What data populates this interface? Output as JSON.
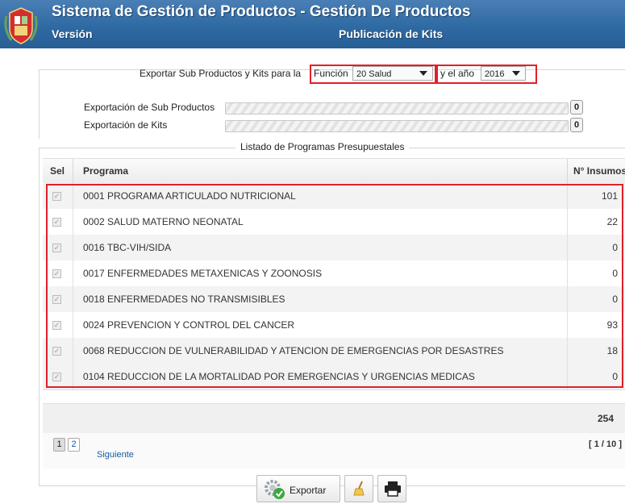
{
  "header": {
    "title": "Sistema de Gestión de Productos - Gestión De Productos",
    "version_label": "Versión",
    "subtitle": "Publicación de Kits"
  },
  "export": {
    "prefix_label": "Exportar Sub Productos y Kits para la",
    "funcion_label": "Función",
    "funcion_value": "20 Salud",
    "anio_label": "y el año",
    "anio_value": "2016",
    "subproductos_label": "Exportación de Sub Productos",
    "subproductos_count": "0",
    "kits_label": "Exportación de Kits",
    "kits_count": "0"
  },
  "list": {
    "legend": "Listado de Programas Presupuestales",
    "columns": {
      "sel": "Sel",
      "programa": "Programa",
      "insumos": "N° Insumos"
    },
    "rows": [
      {
        "programa": "0001 PROGRAMA ARTICULADO NUTRICIONAL",
        "insumos": "101",
        "checked": true
      },
      {
        "programa": "0002 SALUD MATERNO NEONATAL",
        "insumos": "22",
        "checked": true
      },
      {
        "programa": "0016 TBC-VIH/SIDA",
        "insumos": "0",
        "checked": true
      },
      {
        "programa": "0017 ENFERMEDADES METAXENICAS Y ZOONOSIS",
        "insumos": "0",
        "checked": true
      },
      {
        "programa": "0018 ENFERMEDADES NO TRANSMISIBLES",
        "insumos": "0",
        "checked": true
      },
      {
        "programa": "0024 PREVENCION Y CONTROL DEL CANCER",
        "insumos": "93",
        "checked": true
      },
      {
        "programa": "0068 REDUCCION DE VULNERABILIDAD Y ATENCION DE EMERGENCIAS POR DESASTRES",
        "insumos": "18",
        "checked": true
      },
      {
        "programa": "0104 REDUCCION DE LA MORTALIDAD POR EMERGENCIAS Y URGENCIAS MEDICAS",
        "insumos": "0",
        "checked": true
      }
    ],
    "total": "254",
    "pager": {
      "page1": "1",
      "page2": "2",
      "next": "Siguiente",
      "info": "[ 1 / 10 ]"
    }
  },
  "buttons": {
    "export": "Exportar"
  },
  "icons": {
    "export": "gear-check-icon",
    "clear": "broom-icon",
    "print": "printer-icon",
    "logo": "coat-of-arms-icon"
  },
  "colors": {
    "header": "#2f6aa3",
    "highlight": "#e0202a",
    "link": "#1a5aa0"
  }
}
